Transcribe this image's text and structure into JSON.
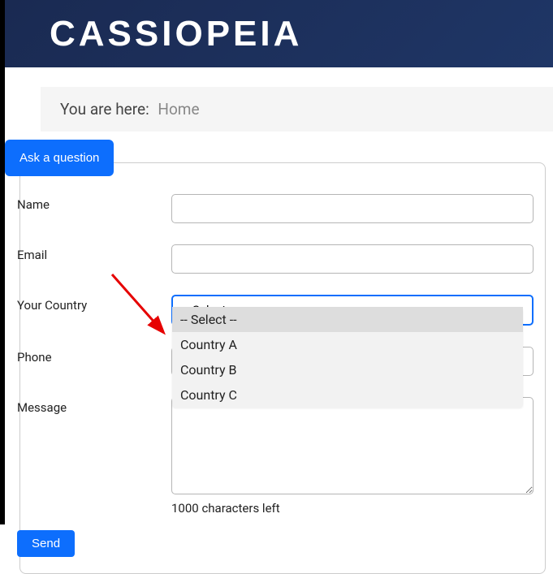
{
  "header": {
    "logo": "CASSIOPEIA"
  },
  "breadcrumb": {
    "label": "You are here:",
    "home": "Home"
  },
  "ghost": "Home",
  "ask_button": "Ask a question",
  "form": {
    "name_label": "Name",
    "email_label": "Email",
    "country_label": "Your Country",
    "country_selected": "-- Select --",
    "phone_label": "Phone",
    "message_label": "Message",
    "chars_left": "1000 characters left",
    "send": "Send",
    "options": [
      "-- Select --",
      "Country A",
      "Country B",
      "Country C"
    ]
  }
}
